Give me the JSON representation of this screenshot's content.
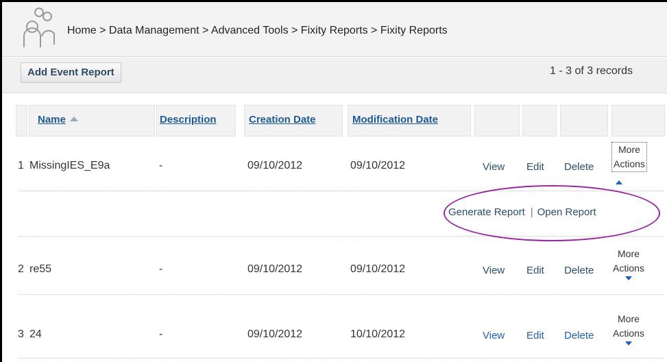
{
  "breadcrumb": {
    "text": "Home > Data Management > Advanced Tools > Fixity Reports > Fixity Reports"
  },
  "toolbar": {
    "add_event_report_label": "Add Event Report",
    "records_text": "1 - 3 of 3 records"
  },
  "table": {
    "columns": {
      "name": "Name",
      "description": "Description",
      "creation_date": "Creation Date",
      "modification_date": "Modification Date"
    },
    "sort": {
      "column": "name",
      "direction": "ascending"
    },
    "rows": [
      {
        "index": "1",
        "name": "MissingIES_E9a",
        "description": "-",
        "creation_date": "09/10/2012",
        "modification_date": "09/10/2012",
        "view": "View",
        "edit": "Edit",
        "delete": "Delete",
        "more_line1": "More",
        "more_line2": "Actions",
        "expanded": true
      },
      {
        "index": "2",
        "name": "re55",
        "description": "-",
        "creation_date": "09/10/2012",
        "modification_date": "09/10/2012",
        "view": "View",
        "edit": "Edit",
        "delete": "Delete",
        "more_line1": "More",
        "more_line2": "Actions",
        "expanded": false
      },
      {
        "index": "3",
        "name": "24",
        "description": "-",
        "creation_date": "09/10/2012",
        "modification_date": "10/10/2012",
        "view": "View",
        "edit": "Edit",
        "delete": "Delete",
        "more_line1": "More",
        "more_line2": "Actions",
        "expanded": false
      }
    ],
    "expanded_actions": {
      "generate_report": "Generate Report",
      "separator": "|",
      "open_report": "Open Report"
    }
  },
  "icons": {
    "logo": "users-group-icon",
    "sort": "sort-up-icon",
    "more_expanded": "caret-up-icon",
    "more_collapsed": "caret-down-icon"
  },
  "colors": {
    "link": "#1c5b9b",
    "action_blue": "#1f5fc0",
    "action_dark": "#2a4e70",
    "highlight_ellipse": "#a020a8"
  }
}
